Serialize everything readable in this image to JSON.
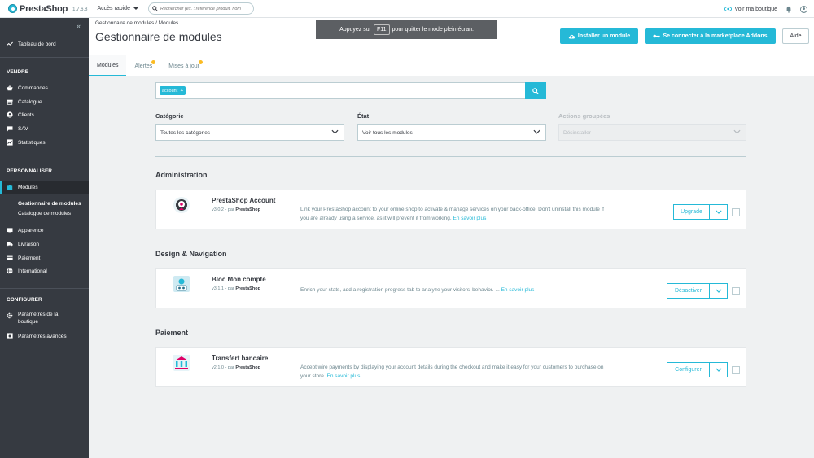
{
  "header": {
    "brand": "PrestaShop",
    "version": "1.7.6.8",
    "quick_access": "Accès rapide",
    "search_placeholder": "Rechercher (ex. : référence produit, nom",
    "view_shop": "Voir ma boutique"
  },
  "sidebar": {
    "dashboard": "Tableau de bord",
    "section_sell": "VENDRE",
    "sell_items": [
      "Commandes",
      "Catalogue",
      "Clients",
      "SAV",
      "Statistiques"
    ],
    "section_customize": "PERSONNALISER",
    "modules": "Modules",
    "modules_sub": [
      "Gestionnaire de modules",
      "Catalogue de modules"
    ],
    "customize_items": [
      "Apparence",
      "Livraison",
      "Paiement",
      "International"
    ],
    "section_configure": "CONFIGURER",
    "configure_items": [
      "Paramètres de la boutique",
      "Paramètres avancés"
    ]
  },
  "page": {
    "breadcrumb": "Gestionnaire de modules  /  Modules",
    "title": "Gestionnaire de modules",
    "fullscreen_prefix": "Appuyez sur",
    "fullscreen_key": "F11",
    "fullscreen_suffix": "pour quitter le mode plein écran.",
    "install_button": "Installer un module",
    "addons_button": "Se connecter à la marketplace Addons",
    "help_button": "Aide",
    "tabs": [
      "Modules",
      "Alertes",
      "Mises à jour"
    ]
  },
  "filters": {
    "tag": "account",
    "category_label": "Catégorie",
    "category_value": "Toutes les catégories",
    "state_label": "État",
    "state_value": "Voir tous les modules",
    "bulk_label": "Actions groupées",
    "bulk_value": "Désinstaller"
  },
  "categories": [
    {
      "title": "Administration",
      "module": {
        "name": "PrestaShop Account",
        "version": "v3.0.2 - par",
        "author": "PrestaShop",
        "description": "Link your PrestaShop account to your online shop to activate & manage services on your back-office. Don't uninstall this module if you are already using a service, as it will prevent it from working.",
        "link": "En savoir plus",
        "action": "Upgrade"
      }
    },
    {
      "title": "Design & Navigation",
      "module": {
        "name": "Bloc Mon compte",
        "version": "v3.1.1 - par",
        "author": "PrestaShop",
        "description": "Enrich your stats, add a registration progress tab to analyze your visitors' behavior. ...",
        "link": "En savoir plus",
        "action": "Désactiver"
      }
    },
    {
      "title": "Paiement",
      "module": {
        "name": "Transfert bancaire",
        "version": "v2.1.0 - par",
        "author": "PrestaShop",
        "description": "Accept wire payments by displaying your account details during the checkout and make it easy for your customers to purchase on your store.",
        "link": "En savoir plus",
        "action": "Configurer"
      }
    }
  ],
  "colors": {
    "accent": "#25b9d7",
    "sidebar": "#363a41",
    "badge": "#fbbb22"
  }
}
